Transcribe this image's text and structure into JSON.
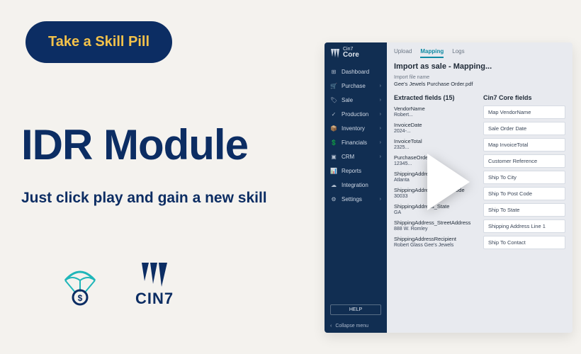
{
  "promo": {
    "pill": "Take a Skill Pill",
    "headline": "IDR Module",
    "subhead": "Just click play and gain a new skill",
    "cin7_word": "CIN7"
  },
  "app": {
    "brand_small": "Cin7",
    "brand_big": "Core",
    "nav": [
      {
        "icon": "⊞",
        "label": "Dashboard",
        "type": "link"
      },
      {
        "icon": "🛒",
        "label": "Purchase",
        "type": "menu"
      },
      {
        "icon": "🏷",
        "label": "Sale",
        "type": "menu"
      },
      {
        "icon": "✓",
        "label": "Production",
        "type": "menu"
      },
      {
        "icon": "📦",
        "label": "Inventory",
        "type": "menu"
      },
      {
        "icon": "💲",
        "label": "Financials",
        "type": "menu"
      },
      {
        "icon": "▣",
        "label": "CRM",
        "type": "menu"
      },
      {
        "icon": "📊",
        "label": "Reports",
        "type": "link"
      },
      {
        "icon": "☁",
        "label": "Integration",
        "type": "link"
      },
      {
        "icon": "⚙",
        "label": "Settings",
        "type": "menu"
      }
    ],
    "help": "HELP",
    "collapse": "Collapse menu",
    "tabs": [
      "Upload",
      "Mapping",
      "Logs"
    ],
    "active_tab": "Mapping",
    "page_title": "Import as sale - Mapping...",
    "import_file_label": "Import file name",
    "import_file_value": "Gee's Jewels Purchase Order.pdf",
    "extracted_header": "Extracted fields (15)",
    "core_header": "Cin7 Core fields",
    "extracted": [
      {
        "key": "VendorName",
        "val": "Robert..."
      },
      {
        "key": "InvoiceDate",
        "val": "2024-..."
      },
      {
        "key": "InvoiceTotal",
        "val": "2325..."
      },
      {
        "key": "PurchaseOrder",
        "val": "12345..."
      },
      {
        "key": "ShippingAddress_City",
        "val": "Atlanta"
      },
      {
        "key": "ShippingAddress_PostalCode",
        "val": "30033"
      },
      {
        "key": "ShippingAddress_State",
        "val": "GA"
      },
      {
        "key": "ShippingAddress_StreetAddress",
        "val": "888 W. Romley"
      },
      {
        "key": "ShippingAddressRecipient",
        "val": "Robert Glass Gee's Jewels"
      }
    ],
    "core_fields": [
      "Map VendorName",
      "Sale Order Date",
      "Map InvoiceTotal",
      "Customer Reference",
      "Ship To City",
      "Ship To Post Code",
      "Ship To State",
      "Shipping Address Line 1",
      "Ship To Contact"
    ]
  }
}
